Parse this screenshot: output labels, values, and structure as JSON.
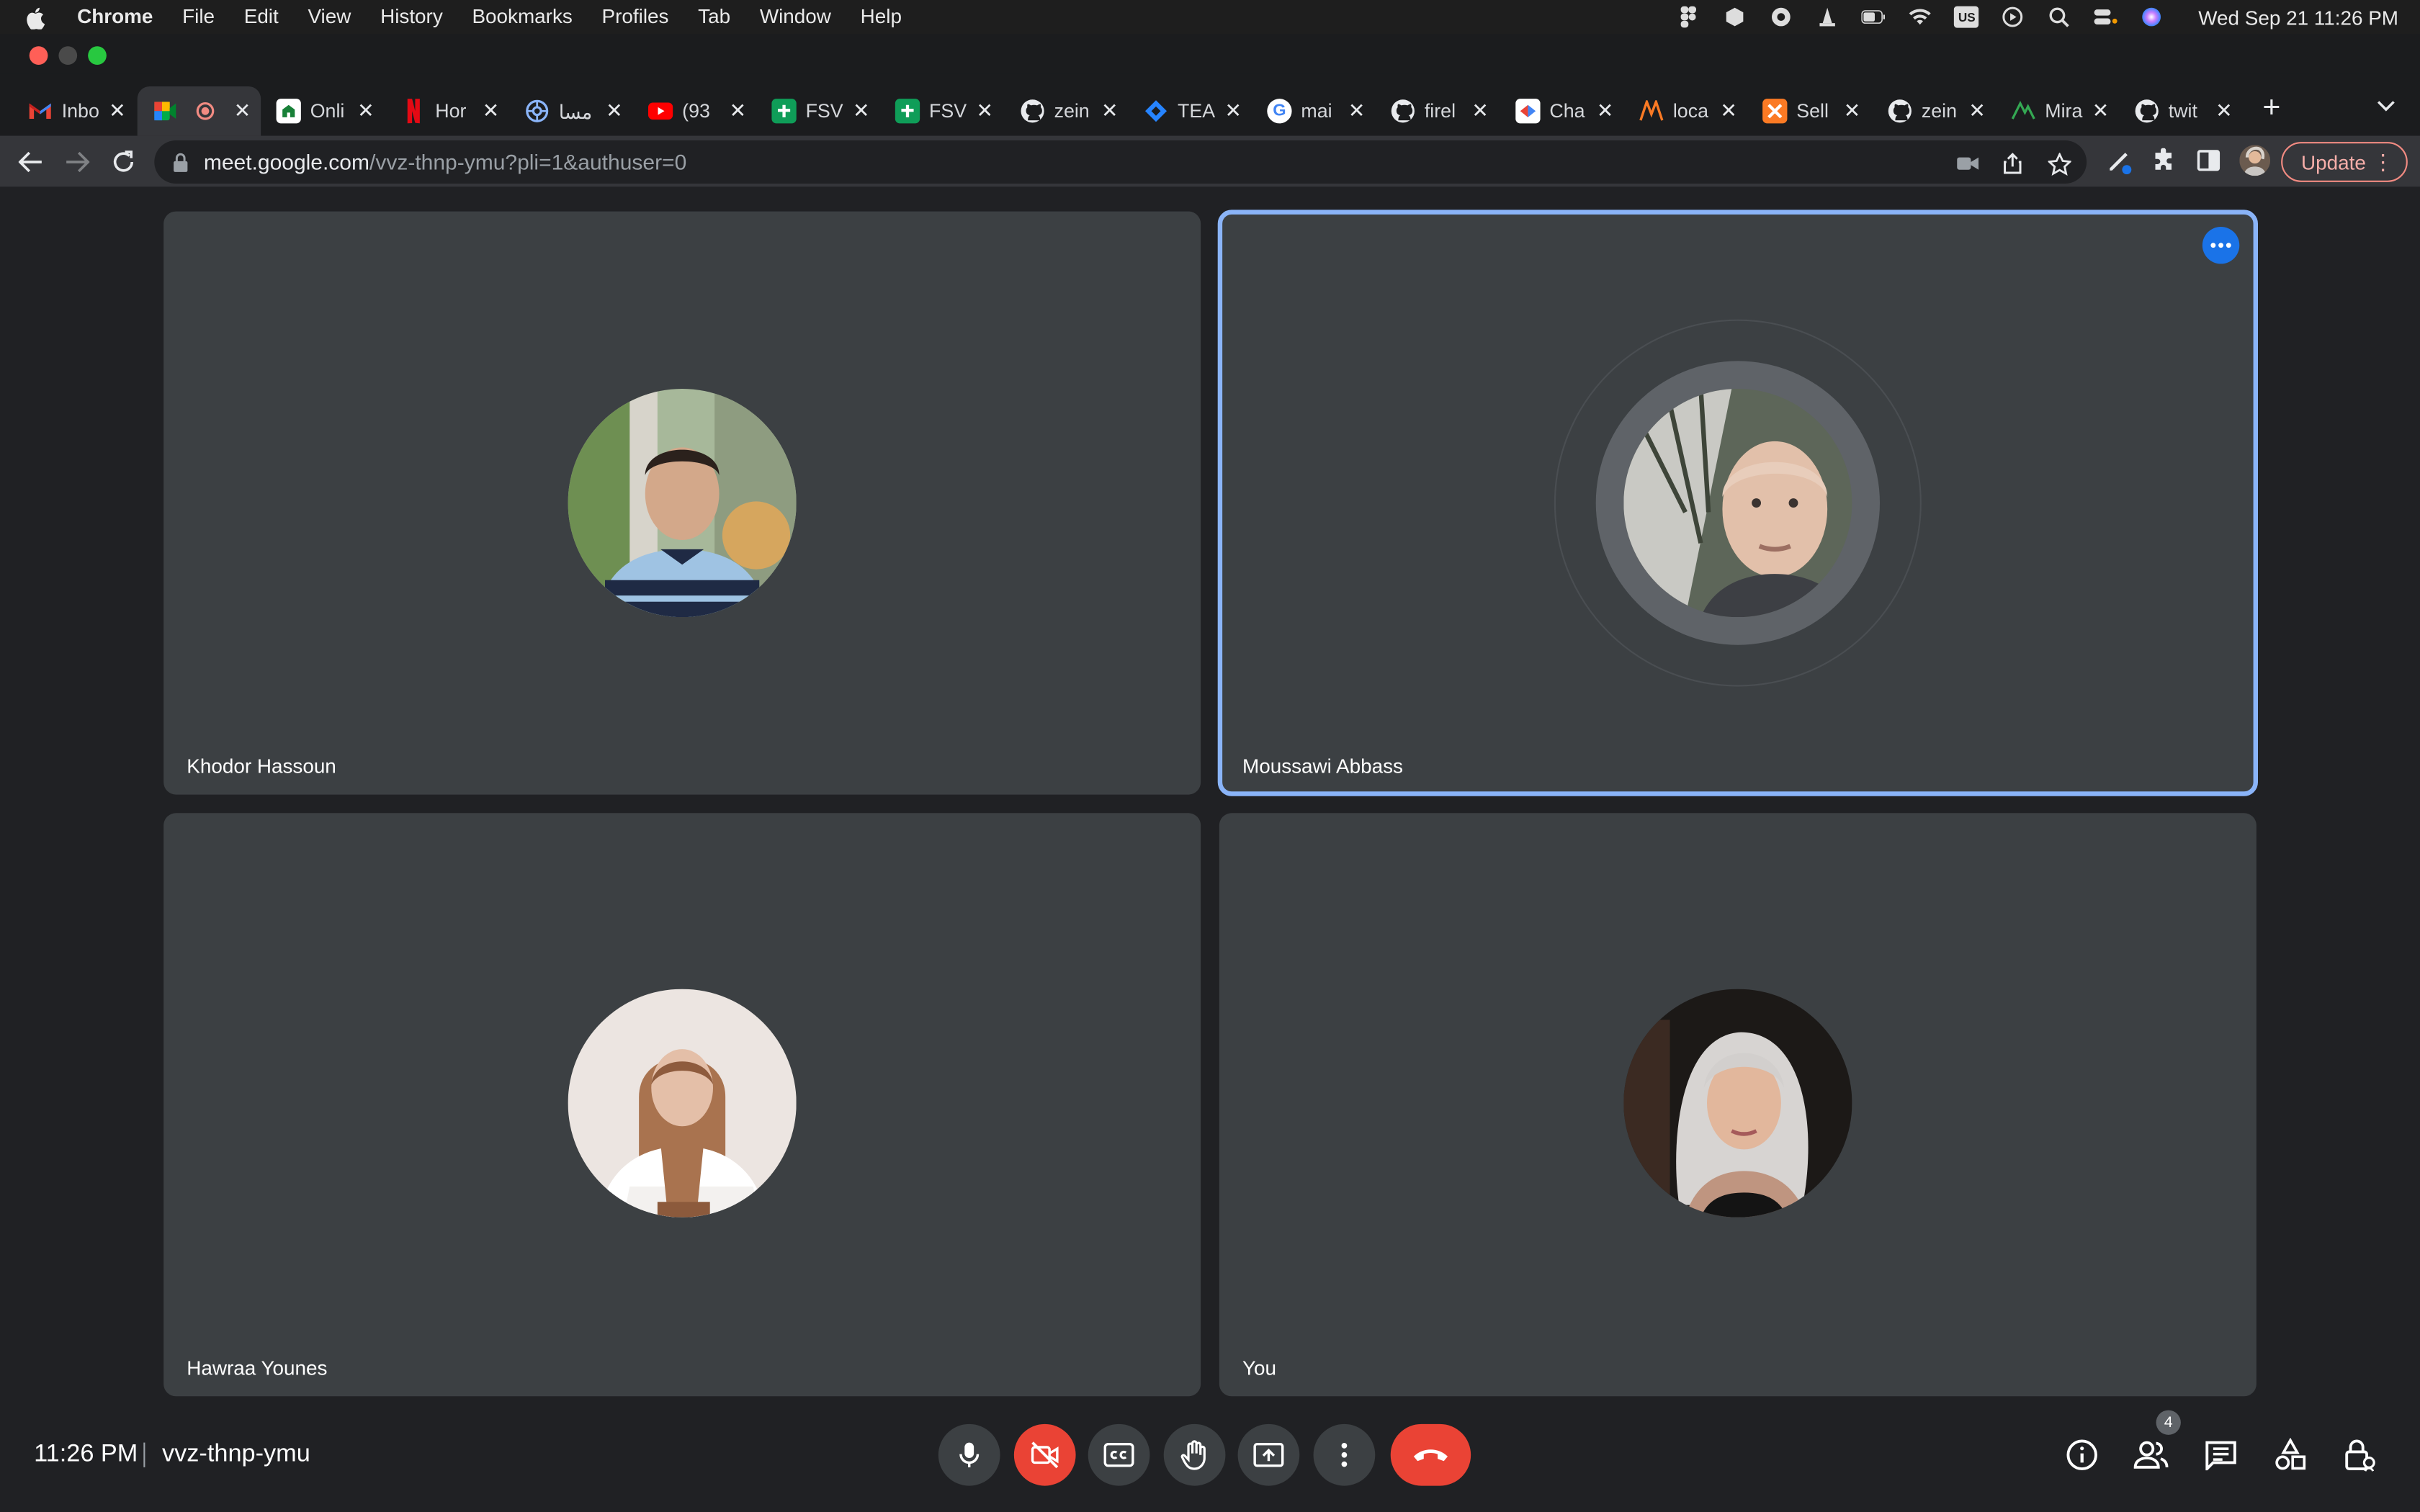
{
  "menubar": {
    "app": "Chrome",
    "menus": [
      "File",
      "Edit",
      "View",
      "History",
      "Bookmarks",
      "Profiles",
      "Tab",
      "Window",
      "Help"
    ],
    "input_source": "US",
    "datetime": "Wed Sep 21  11:26 PM"
  },
  "tabs": [
    {
      "title": "Inbo",
      "favicon": "gmail-icon"
    },
    {
      "title": "",
      "favicon": "meet-icon",
      "active": true
    },
    {
      "title": "Onli",
      "favicon": "site-icon"
    },
    {
      "title": "Hor",
      "favicon": "netflix-icon"
    },
    {
      "title": "مسا",
      "favicon": "globe-icon"
    },
    {
      "title": "(93",
      "favicon": "youtube-icon"
    },
    {
      "title": "FSV",
      "favicon": "sheets-icon"
    },
    {
      "title": "FSV",
      "favicon": "sheets-icon"
    },
    {
      "title": "zein",
      "favicon": "github-icon"
    },
    {
      "title": "TEA",
      "favicon": "jira-icon"
    },
    {
      "title": "mai",
      "favicon": "google-icon"
    },
    {
      "title": "firel",
      "favicon": "github-icon"
    },
    {
      "title": "Cha",
      "favicon": "site-icon"
    },
    {
      "title": "loca",
      "favicon": "xampp-icon"
    },
    {
      "title": "Sell",
      "favicon": "xampp-icon"
    },
    {
      "title": "zein",
      "favicon": "github-icon"
    },
    {
      "title": "Mira",
      "favicon": "miro-icon"
    },
    {
      "title": "twit",
      "favicon": "github-icon"
    }
  ],
  "address": {
    "host": "meet.google.com",
    "path": "/vvz-thnp-ymu?pli=1&authuser=0"
  },
  "update_label": "Update",
  "participants": [
    {
      "name": "Khodor Hassoun"
    },
    {
      "name": "Moussawi Abbass",
      "speaking": true
    },
    {
      "name": "Hawraa Younes"
    },
    {
      "name": "You"
    }
  ],
  "meeting": {
    "time": "11:26 PM",
    "code": "vvz-thnp-ymu",
    "people_count": "4"
  },
  "colors": {
    "background": "#202124",
    "tile": "#3c4043",
    "speaking_border": "#8ab4f8",
    "danger": "#ea4335"
  }
}
